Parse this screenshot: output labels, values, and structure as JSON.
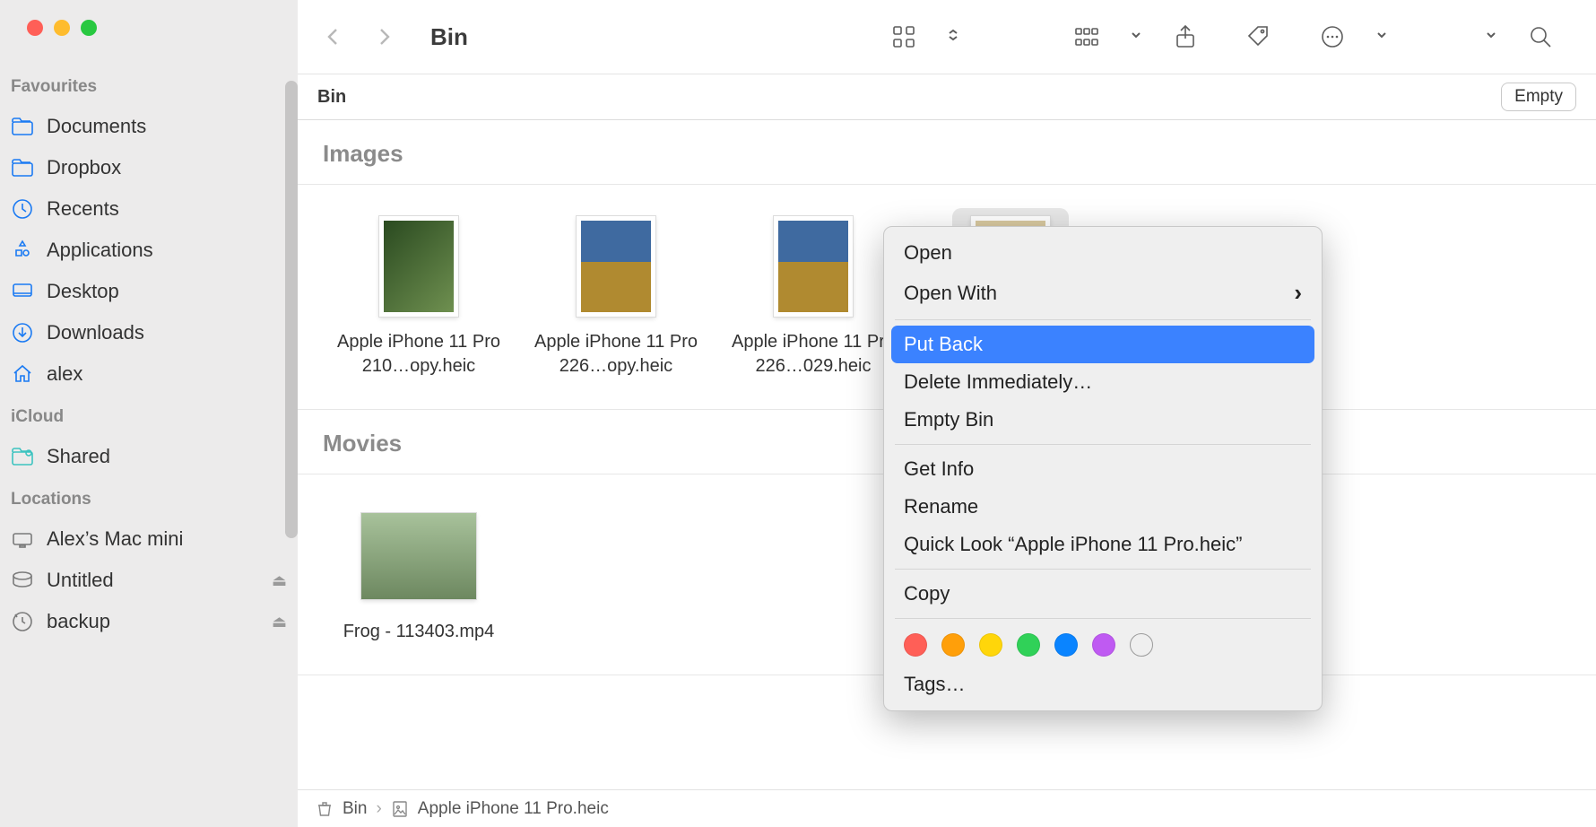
{
  "window": {
    "title": "Bin"
  },
  "sidebar": {
    "sections": [
      {
        "header": "Favourites",
        "items": [
          {
            "label": "Documents",
            "icon": "folder-icon"
          },
          {
            "label": "Dropbox",
            "icon": "folder-icon"
          },
          {
            "label": "Recents",
            "icon": "clock-icon"
          },
          {
            "label": "Applications",
            "icon": "apps-icon"
          },
          {
            "label": "Desktop",
            "icon": "desktop-icon"
          },
          {
            "label": "Downloads",
            "icon": "download-icon"
          },
          {
            "label": "alex",
            "icon": "home-icon"
          }
        ]
      },
      {
        "header": "iCloud",
        "items": [
          {
            "label": "Shared",
            "icon": "shared-folder-icon"
          }
        ]
      },
      {
        "header": "Locations",
        "items": [
          {
            "label": "Alex’s Mac mini",
            "icon": "computer-icon"
          },
          {
            "label": "Untitled",
            "icon": "disk-icon",
            "eject": true
          },
          {
            "label": "backup",
            "icon": "timemachine-icon",
            "eject": true
          }
        ]
      }
    ]
  },
  "toolbar": {
    "path_label": "Bin",
    "empty_label": "Empty"
  },
  "groups": [
    {
      "title": "Images",
      "files": [
        {
          "name": "Apple iPhone 11 Pro 210…opy.heic",
          "thumb": "img-a",
          "selected": false
        },
        {
          "name": "Apple iPhone 11 Pro 226…opy.heic",
          "thumb": "img-b",
          "selected": false
        },
        {
          "name": "Apple iPhone 11 Pro 226…029.heic",
          "thumb": "img-c",
          "selected": false
        },
        {
          "name": "Apple iPhone 11 Pro.heic",
          "thumb": "img-d",
          "selected": true
        }
      ]
    },
    {
      "title": "Movies",
      "files": [
        {
          "name": "Frog - 113403.mp4",
          "thumb": "img-e",
          "selected": false,
          "movie": true
        }
      ]
    }
  ],
  "context_menu": {
    "items": [
      {
        "label": "Open",
        "type": "item"
      },
      {
        "label": "Open With",
        "type": "submenu"
      },
      {
        "type": "sep"
      },
      {
        "label": "Put Back",
        "type": "item",
        "highlighted": true
      },
      {
        "label": "Delete Immediately…",
        "type": "item"
      },
      {
        "label": "Empty Bin",
        "type": "item"
      },
      {
        "type": "sep"
      },
      {
        "label": "Get Info",
        "type": "item"
      },
      {
        "label": "Rename",
        "type": "item"
      },
      {
        "label": "Quick Look “Apple iPhone 11 Pro.heic”",
        "type": "item"
      },
      {
        "type": "sep"
      },
      {
        "label": "Copy",
        "type": "item"
      },
      {
        "type": "sep"
      },
      {
        "type": "tags",
        "colors": [
          "#ff5f57",
          "#ff9f0a",
          "#ffd60a",
          "#30d158",
          "#0a84ff",
          "#bf5af2",
          "#ffffff"
        ]
      },
      {
        "label": "Tags…",
        "type": "item"
      }
    ]
  },
  "footer": {
    "crumbs": [
      {
        "label": "Bin",
        "icon": "trash-icon"
      },
      {
        "label": "Apple iPhone 11 Pro.heic",
        "icon": "image-file-icon"
      }
    ]
  }
}
